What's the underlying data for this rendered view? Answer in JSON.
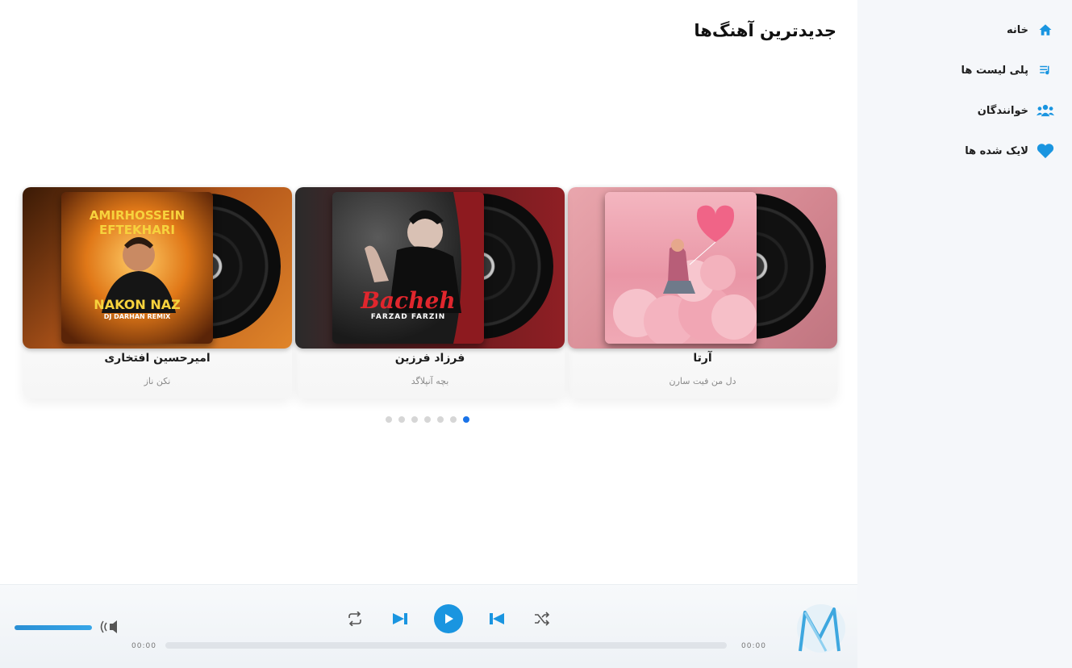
{
  "sidebar": {
    "items": [
      {
        "label": "خانه",
        "icon": "home-icon"
      },
      {
        "label": "پلی لیست ها",
        "icon": "playlist-icon"
      },
      {
        "label": "خوانندگان",
        "icon": "singers-icon"
      },
      {
        "label": "لایک شده ها",
        "icon": "heart-icon"
      }
    ]
  },
  "main": {
    "title": "جدیدترین آهنگ‌ها"
  },
  "cards": [
    {
      "artist": "آرتا",
      "song": "دل من فیت سارن",
      "cover_title": "",
      "cover_subtitle": ""
    },
    {
      "artist": "فرزاد فرزین",
      "song": "بچه آنپلاگد",
      "cover_title": "Bacheh",
      "cover_subtitle": "FARZAD FARZIN"
    },
    {
      "artist": "امیرحسین افتخاری",
      "song": "نکن ناز",
      "cover_title": "AMIRHOSSEIN EFTEKHARI",
      "cover_subtitle": "NAKON NAZ",
      "cover_footer": "DJ DARHAN REMIX"
    }
  ],
  "carousel": {
    "dot_count": 7,
    "active_index": 6
  },
  "player": {
    "time_elapsed": "00:00",
    "time_total": "00:00",
    "volume": 1.0,
    "progress": 0.0
  },
  "colors": {
    "accent": "#1a95e0",
    "sidebar_bg": "#f5f7fa"
  }
}
